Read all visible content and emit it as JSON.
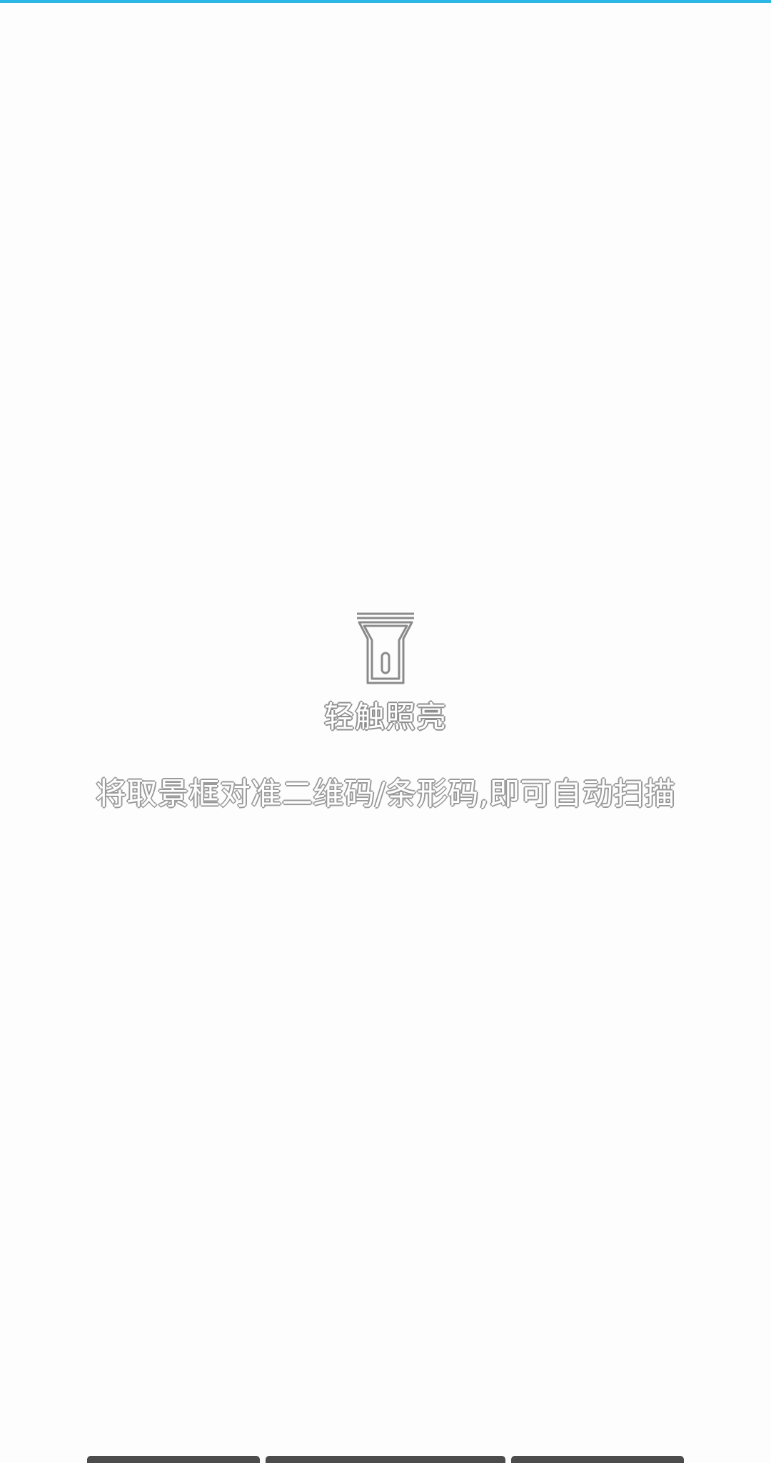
{
  "torch": {
    "label": "轻触照亮",
    "icon": "flashlight-icon"
  },
  "hint": {
    "text": "将取景框对准二维码/条形码,即可自动扫描"
  },
  "colors": {
    "scan_line": "#2db7e4",
    "background": "#fdfdfd",
    "text_outline": "#8f8f8f",
    "tab_bar": "#4c4c4c"
  }
}
